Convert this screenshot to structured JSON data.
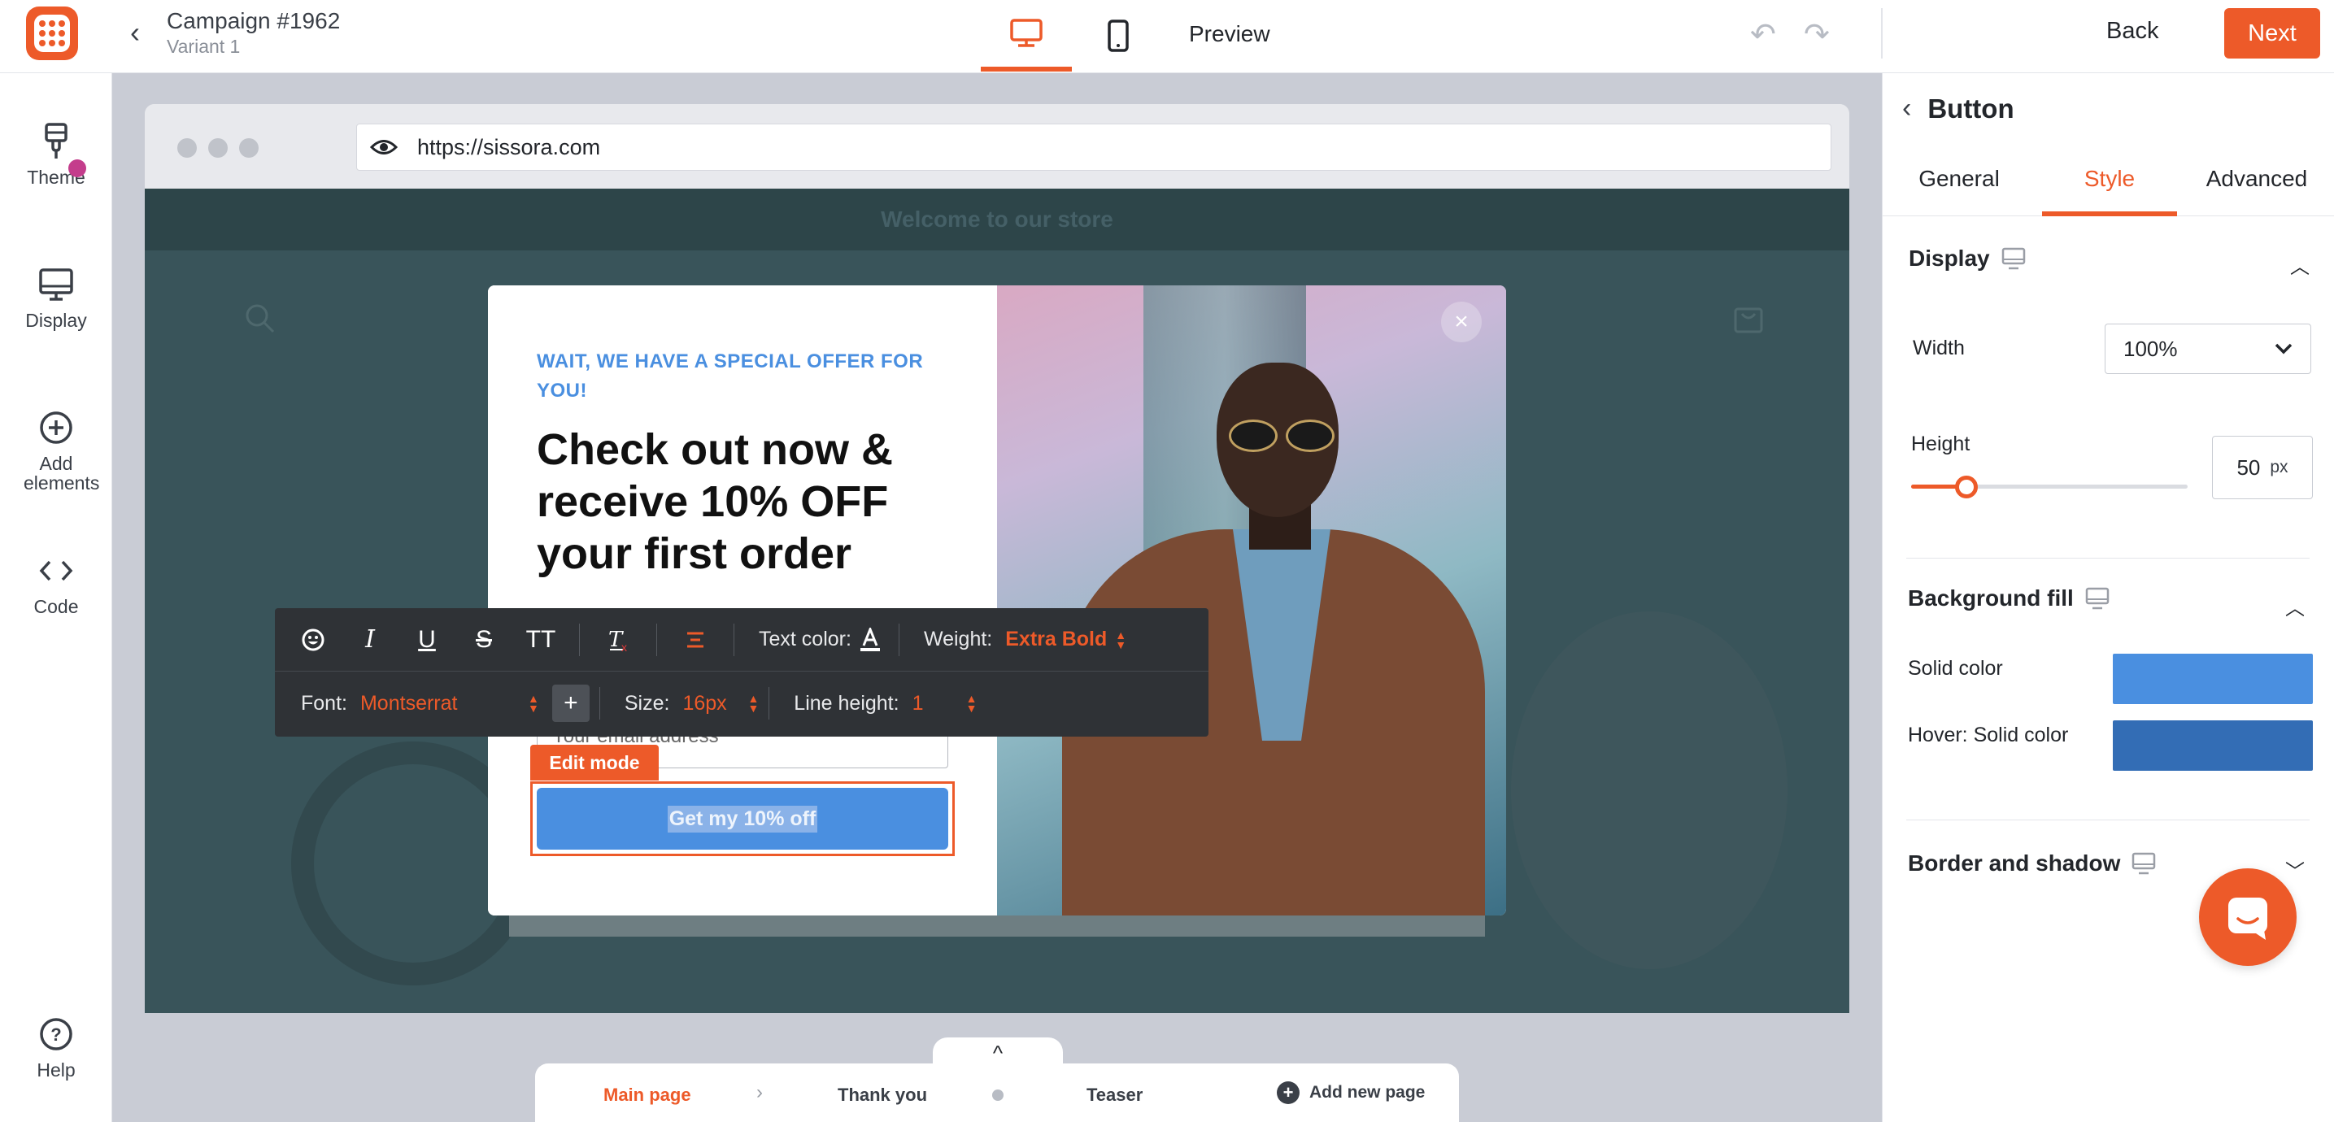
{
  "header": {
    "campaign_title": "Campaign #1962",
    "variant": "Variant 1",
    "preview_label": "Preview",
    "back_label": "Back",
    "next_label": "Next",
    "accent_color": "#ed5a29"
  },
  "sidebar": {
    "items": [
      {
        "label": "Theme",
        "icon": "paint-brush-icon"
      },
      {
        "label": "Display",
        "icon": "monitor-icon"
      },
      {
        "label": "Add elements",
        "icon": "plus-circle-icon"
      },
      {
        "label": "Code",
        "icon": "code-icon"
      },
      {
        "label": "Help",
        "icon": "help-circle-icon"
      }
    ]
  },
  "canvas": {
    "url": "https://sissora.com",
    "site_banner": "Welcome to our store"
  },
  "popup": {
    "eyebrow": "WAIT, WE HAVE A SPECIAL OFFER FOR YOU!",
    "headline": "Check out now & receive 10% OFF your first order",
    "email_placeholder": "Your email address",
    "cta_label": "Get my 10% off",
    "edit_mode_label": "Edit mode",
    "close_glyph": "×",
    "primary_color": "#4a8fe0"
  },
  "text_toolbar": {
    "text_color_label": "Text color:",
    "weight_label": "Weight:",
    "weight_value": "Extra Bold",
    "font_label": "Font:",
    "font_value": "Montserrat",
    "size_label": "Size:",
    "size_value": "16px",
    "line_height_label": "Line height:",
    "line_height_value": "1",
    "tt_glyph": "TT"
  },
  "pages": {
    "toggle_glyph": "^",
    "tabs": [
      {
        "label": "Main page",
        "active": true
      },
      {
        "label": "Thank you",
        "active": false
      },
      {
        "label": "Teaser",
        "active": false
      }
    ],
    "add_label": "Add new page"
  },
  "right_panel": {
    "title": "Button",
    "tabs": [
      "General",
      "Style",
      "Advanced"
    ],
    "active_tab": "Style",
    "display": {
      "title": "Display",
      "width_label": "Width",
      "width_value": "100%",
      "height_label": "Height",
      "height_value": "50",
      "height_unit": "px",
      "height_slider_fraction": 0.2
    },
    "background_fill": {
      "title": "Background fill",
      "solid_label": "Solid color",
      "solid_color": "#4a8fe0",
      "hover_label": "Hover: Solid color",
      "hover_color": "#336db5"
    },
    "border_shadow": {
      "title": "Border and shadow"
    }
  }
}
